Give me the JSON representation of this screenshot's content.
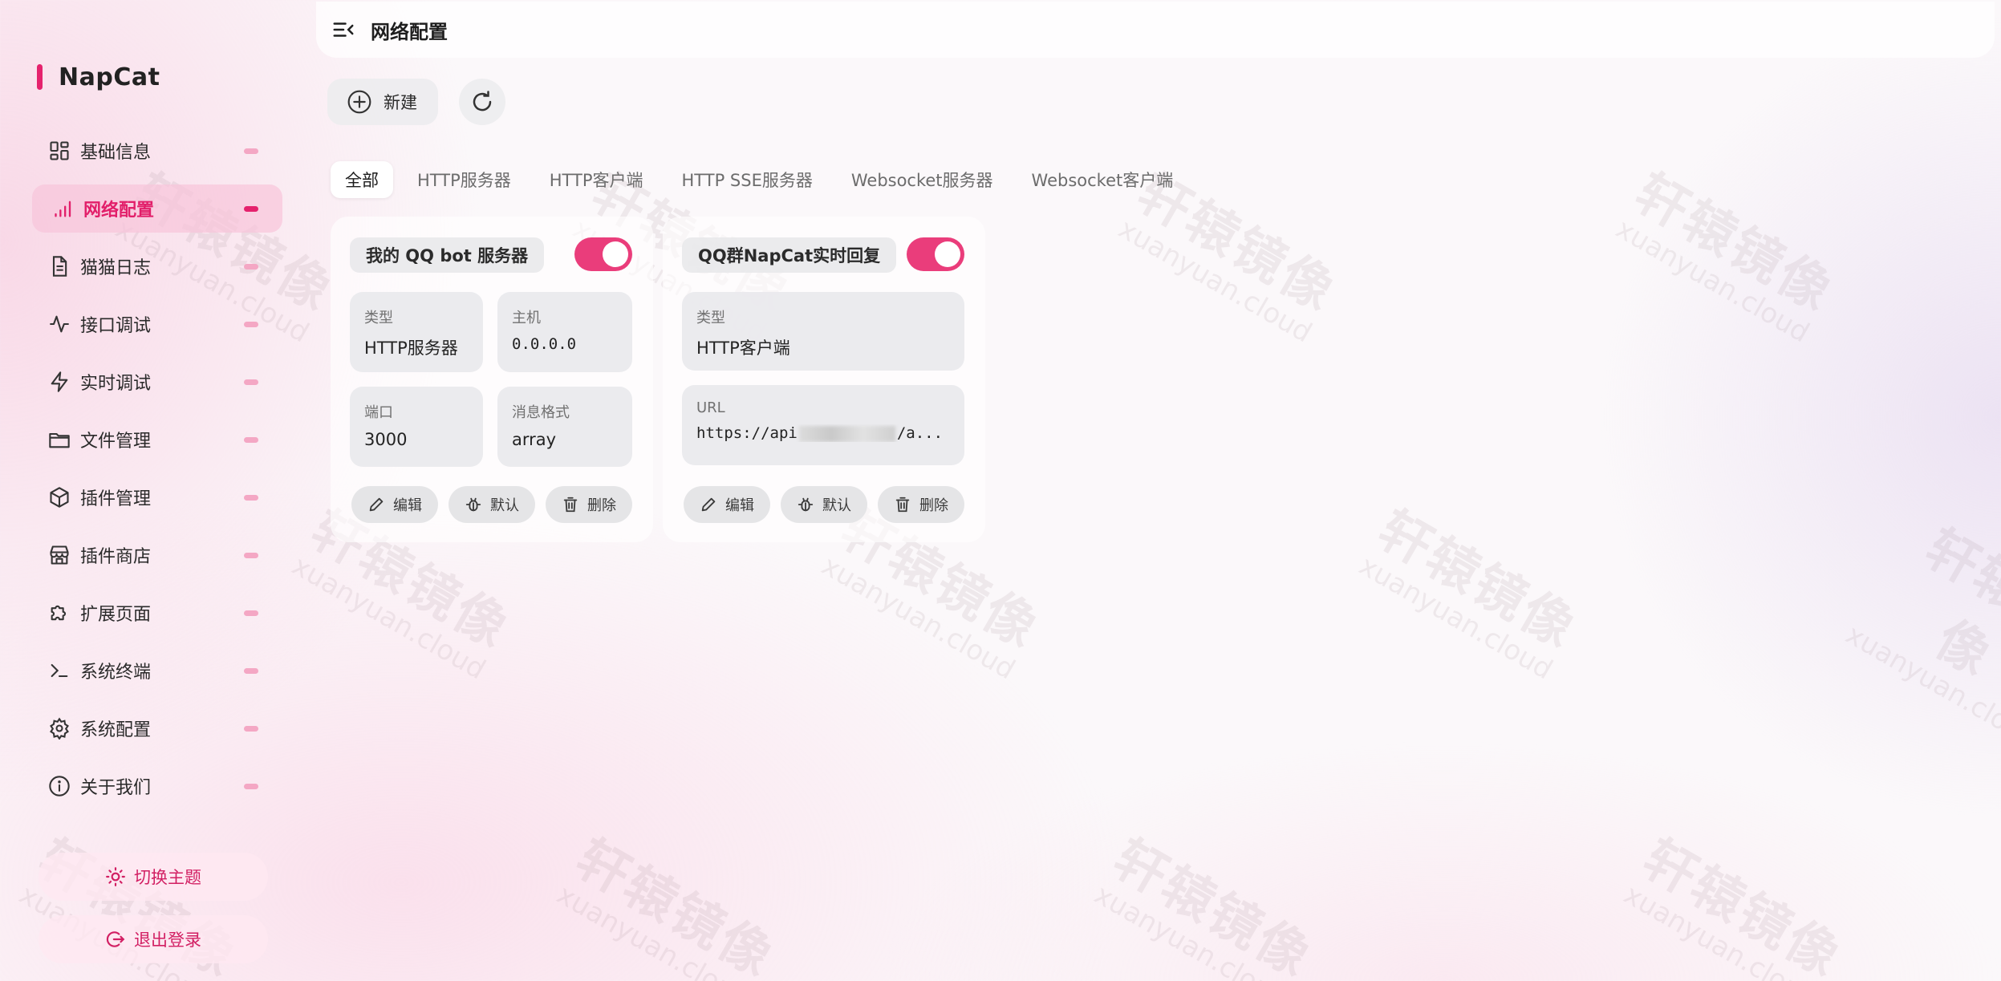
{
  "app": {
    "name": "NapCat"
  },
  "header": {
    "title": "网络配置"
  },
  "sidebar": {
    "items": [
      {
        "label": "基础信息",
        "icon": "dashboard-icon",
        "active": false
      },
      {
        "label": "网络配置",
        "icon": "signal-icon",
        "active": true
      },
      {
        "label": "猫猫日志",
        "icon": "document-icon",
        "active": false
      },
      {
        "label": "接口调试",
        "icon": "activity-icon",
        "active": false
      },
      {
        "label": "实时调试",
        "icon": "lightning-icon",
        "active": false
      },
      {
        "label": "文件管理",
        "icon": "folder-icon",
        "active": false
      },
      {
        "label": "插件管理",
        "icon": "package-icon",
        "active": false
      },
      {
        "label": "插件商店",
        "icon": "store-icon",
        "active": false
      },
      {
        "label": "扩展页面",
        "icon": "puzzle-icon",
        "active": false
      },
      {
        "label": "系统终端",
        "icon": "terminal-icon",
        "active": false
      },
      {
        "label": "系统配置",
        "icon": "gear-icon",
        "active": false
      },
      {
        "label": "关于我们",
        "icon": "info-icon",
        "active": false
      }
    ],
    "theme_button": "切换主题",
    "logout_button": "退出登录"
  },
  "toolbar": {
    "new_label": "新建"
  },
  "tabs": [
    {
      "label": "全部",
      "active": true
    },
    {
      "label": "HTTP服务器",
      "active": false
    },
    {
      "label": "HTTP客户端",
      "active": false
    },
    {
      "label": "HTTP SSE服务器",
      "active": false
    },
    {
      "label": "Websocket服务器",
      "active": false
    },
    {
      "label": "Websocket客户端",
      "active": false
    }
  ],
  "cards": [
    {
      "name": "我的 QQ bot 服务器",
      "enabled": true,
      "type_label": "类型",
      "type_value": "HTTP服务器",
      "host_label": "主机",
      "host_value": "0.0.0.0",
      "port_label": "端口",
      "port_value": "3000",
      "format_label": "消息格式",
      "format_value": "array"
    },
    {
      "name": "QQ群NapCat实时回复",
      "enabled": true,
      "type_label": "类型",
      "type_value": "HTTP客户端",
      "url_label": "URL",
      "url_prefix": "https://api",
      "url_suffix": "/a..."
    }
  ],
  "card_actions": {
    "edit": "编辑",
    "default": "默认",
    "delete": "删除"
  },
  "watermark": {
    "text": "轩辕镜像",
    "subtext": "xuanyuan.cloud"
  },
  "colors": {
    "accent": "#e5226d",
    "toggle": "#ea3d7b"
  }
}
